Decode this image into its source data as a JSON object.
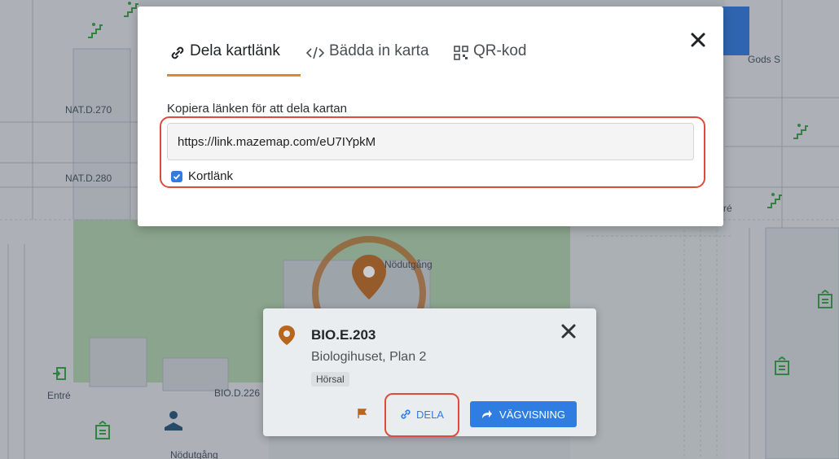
{
  "map": {
    "labels": {
      "nat_d_270": "NAT.D.270",
      "nat_d_280": "NAT.D.280",
      "gods": "Gods S",
      "entre": "Entré",
      "bio_d_226": "BIO.D.226",
      "nodutgang_top": "Nödutgång",
      "nodutgang_bottom": "Nödutgång",
      "re": "ré"
    }
  },
  "share_modal": {
    "tabs": [
      {
        "label": "Dela kartlänk",
        "icon": "link-icon",
        "active": true
      },
      {
        "label": "Bädda in karta",
        "icon": "code-icon",
        "active": false
      },
      {
        "label": "QR-kod",
        "icon": "qr-code-icon",
        "active": false
      }
    ],
    "copy_label": "Kopiera länken för att dela kartan",
    "link_value": "https://link.mazemap.com/eU7IYpkM",
    "short_link_label": "Kortlänk",
    "short_link_checked": true
  },
  "place_card": {
    "title": "BIO.E.203",
    "subtitle": "Biologihuset, Plan 2",
    "tag": "Hörsal",
    "share_label": "DELA",
    "navigate_label": "VÄGVISNING"
  },
  "colors": {
    "accent_orange": "#e8842f",
    "pin_orange": "#b8651e",
    "primary_blue": "#2f7de1",
    "highlight_red": "#e04a3c",
    "green_icon": "#2e9a3e"
  }
}
